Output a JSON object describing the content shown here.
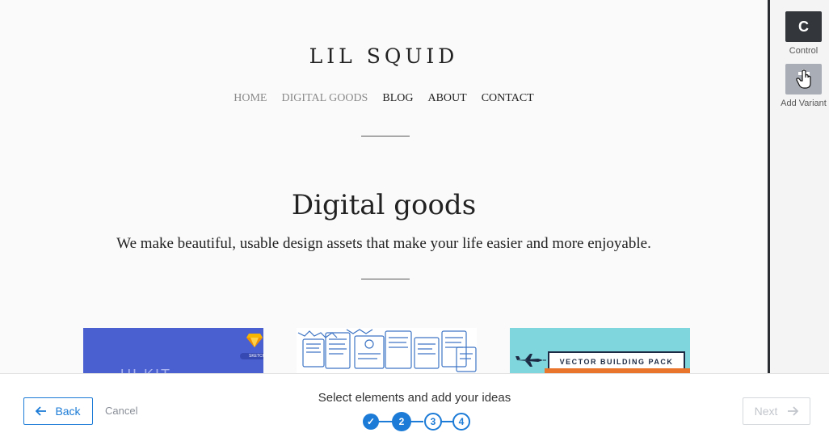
{
  "site": {
    "title": "LIL SQUID",
    "nav": [
      "HOME",
      "DIGITAL GOODS",
      "BLOG",
      "ABOUT",
      "CONTACT"
    ],
    "heading": "Digital goods",
    "subheading": "We make beautiful, usable design assets that make your life easier and more enjoyable.",
    "cards": [
      {
        "text": "UI KIT",
        "badge": "SKETCH"
      },
      {
        "text": ""
      },
      {
        "text": "VECTOR BUILDING PACK"
      }
    ]
  },
  "panel": {
    "control_letter": "C",
    "control_label": "Control",
    "add_variant_label": "Add Variant"
  },
  "wizard": {
    "back_label": "Back",
    "cancel_label": "Cancel",
    "step_label": "Select elements and add your ideas",
    "steps": [
      "✓",
      "2",
      "3",
      "4"
    ],
    "current_step": 2,
    "next_label": "Next"
  },
  "colors": {
    "accent": "#1b7bd6",
    "dark": "#33373c"
  },
  "icons": [
    "arrow-left-icon",
    "arrow-right-icon",
    "check-icon",
    "plus-icon",
    "hand-cursor-icon",
    "sketch-diamond-icon",
    "airplane-icon"
  ]
}
